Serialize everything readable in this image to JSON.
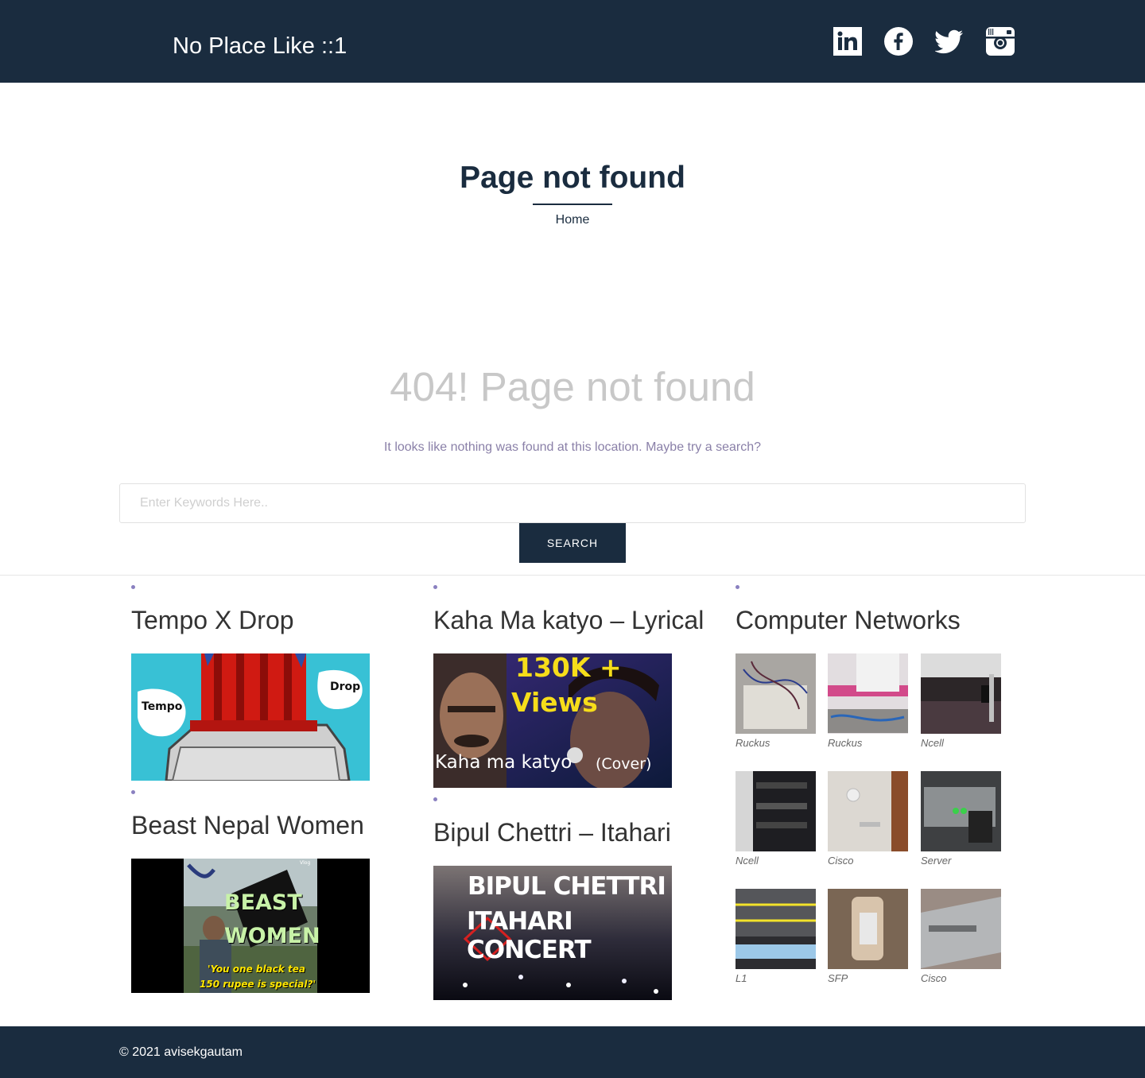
{
  "header": {
    "site_title": "No Place Like ::1",
    "social": [
      "linkedin-icon",
      "facebook-icon",
      "twitter-icon",
      "instagram-icon"
    ]
  },
  "hero": {
    "title": "Page not found",
    "breadcrumb": "Home"
  },
  "not_found": {
    "heading": "404! Page not found",
    "message": "It looks like nothing was found at this location. Maybe try a search?",
    "search_placeholder": "Enter Keywords Here..",
    "search_button": "SEARCH"
  },
  "widgets": {
    "col1": [
      {
        "title": "Tempo X Drop",
        "thumb_left": "Tempo",
        "thumb_right": "Drop"
      },
      {
        "title": "Beast Nepal Women",
        "thumb_line1": "BEAST",
        "thumb_line2": "WOMEN",
        "thumb_caption1": "'You one black tea",
        "thumb_caption2": "150 rupee is special?'",
        "thumb_tag": "Vlog"
      }
    ],
    "col2": [
      {
        "title": "Kaha Ma katyo – Lyrical",
        "thumb_line1": "130K +",
        "thumb_line2": "Views",
        "thumb_line3": "Kaha ma katyo",
        "thumb_line4": "(Cover)"
      },
      {
        "title": "Bipul Chettri – Itahari",
        "thumb_line1": "BIPUL CHETTRI",
        "thumb_line2": "ITAHARI CONCERT"
      }
    ],
    "col3": {
      "title": "Computer Networks",
      "gallery": [
        {
          "caption": "Ruckus"
        },
        {
          "caption": "Ruckus"
        },
        {
          "caption": "Ncell"
        },
        {
          "caption": "Ncell"
        },
        {
          "caption": "Cisco"
        },
        {
          "caption": "Server"
        },
        {
          "caption": "L1"
        },
        {
          "caption": "SFP"
        },
        {
          "caption": "Cisco"
        }
      ]
    }
  },
  "footer": {
    "copyright": "© 2021 avisekgautam"
  },
  "colors": {
    "primary": "#1a2c3f",
    "muted_heading": "#c8c8c8",
    "message": "#8a80a8",
    "accent_dot": "#8a80c0"
  }
}
